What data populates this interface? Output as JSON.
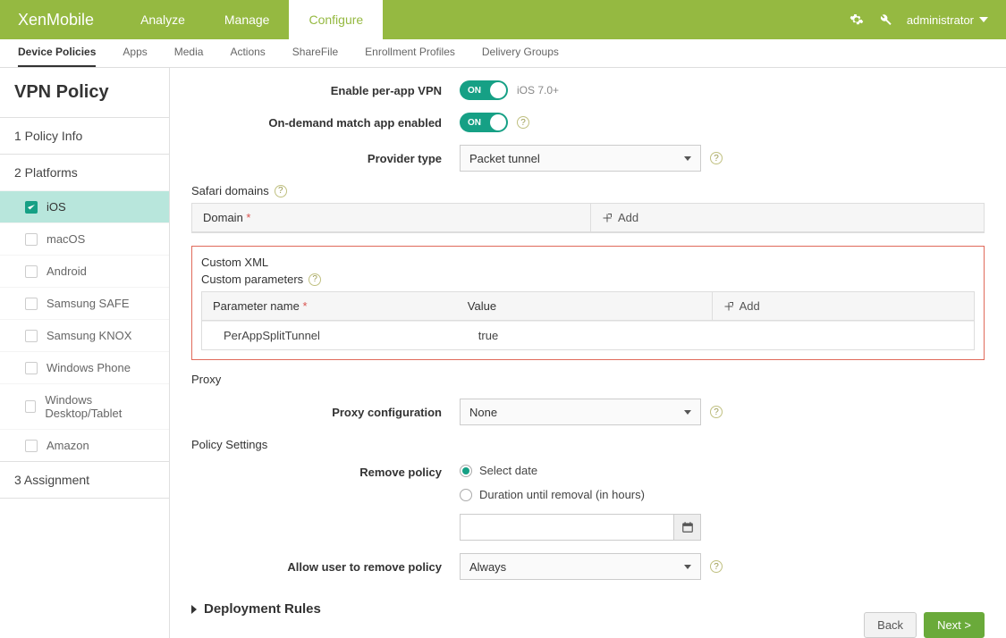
{
  "brand": "XenMobile",
  "topnav": [
    "Analyze",
    "Manage",
    "Configure"
  ],
  "topnav_active": 2,
  "admin_label": "administrator",
  "subnav": [
    "Device Policies",
    "Apps",
    "Media",
    "Actions",
    "ShareFile",
    "Enrollment Profiles",
    "Delivery Groups"
  ],
  "subnav_active": 0,
  "sidebar": {
    "title": "VPN Policy",
    "steps": [
      "1  Policy Info",
      "2  Platforms",
      "3  Assignment"
    ],
    "platforms": [
      "iOS",
      "macOS",
      "Android",
      "Samsung SAFE",
      "Samsung KNOX",
      "Windows Phone",
      "Windows Desktop/Tablet",
      "Amazon"
    ],
    "active_platform": 0
  },
  "form": {
    "enable_per_app_label": "Enable per-app VPN",
    "enable_per_app_hint": "iOS 7.0+",
    "on_demand_label": "On-demand match app enabled",
    "provider_type_label": "Provider type",
    "provider_type_value": "Packet tunnel",
    "toggle_on": "ON",
    "safari_domains_label": "Safari domains",
    "safari_table": {
      "col_domain": "Domain",
      "add": "Add"
    },
    "custom_xml_label": "Custom XML",
    "custom_params_label": "Custom parameters",
    "custom_table": {
      "col_name": "Parameter name",
      "col_value": "Value",
      "add": "Add",
      "rows": [
        {
          "name": "PerAppSplitTunnel",
          "value": "true"
        }
      ]
    },
    "proxy_section": "Proxy",
    "proxy_config_label": "Proxy configuration",
    "proxy_config_value": "None",
    "policy_settings_section": "Policy Settings",
    "remove_policy_label": "Remove policy",
    "remove_policy_options": [
      "Select date",
      "Duration until removal (in hours)"
    ],
    "allow_remove_label": "Allow user to remove policy",
    "allow_remove_value": "Always",
    "deployment_rules": "Deployment Rules"
  },
  "buttons": {
    "back": "Back",
    "next": "Next >"
  }
}
